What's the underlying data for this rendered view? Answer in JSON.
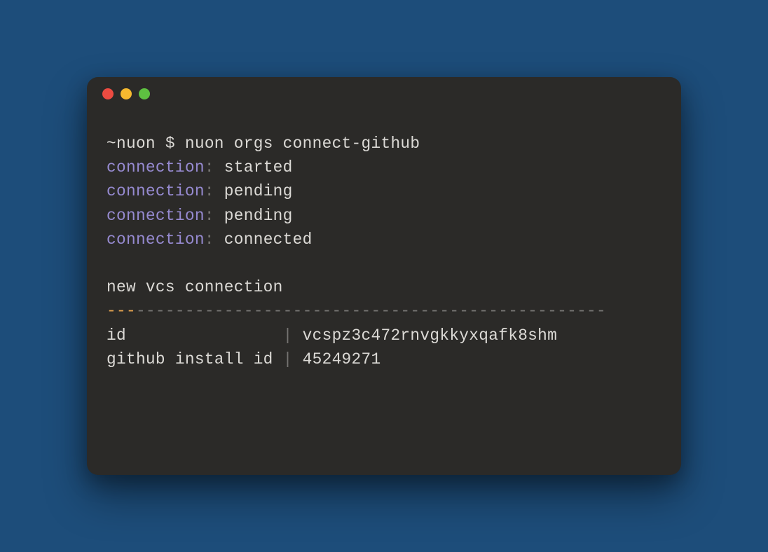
{
  "prompt": {
    "path": "~nuon",
    "symbol": " $ ",
    "command": "nuon orgs connect-github"
  },
  "statuses": [
    {
      "label": "connection",
      "colon": ":",
      "value": " started"
    },
    {
      "label": "connection",
      "colon": ":",
      "value": " pending"
    },
    {
      "label": "connection",
      "colon": ":",
      "value": " pending"
    },
    {
      "label": "connection",
      "colon": ":",
      "value": " connected"
    }
  ],
  "section_title": "new vcs connection",
  "divider": {
    "orange": "---",
    "gray": "------------------------------------------------"
  },
  "table": [
    {
      "key": "id               ",
      "sep": " | ",
      "value": "vcspz3c472rnvgkkyxqafk8shm"
    },
    {
      "key": "github install id",
      "sep": " | ",
      "value": "45249271"
    }
  ]
}
